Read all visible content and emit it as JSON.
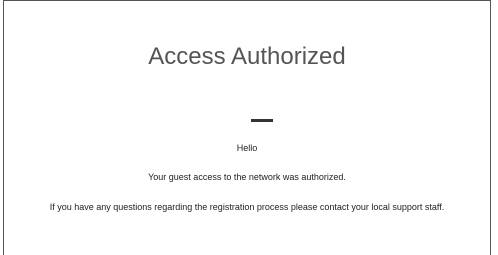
{
  "page": {
    "title": "Access Authorized",
    "greeting": "Hello",
    "message": "Your guest access to the network was authorized.",
    "contact": "If you have any questions regarding the registration process please contact your local support staff."
  }
}
